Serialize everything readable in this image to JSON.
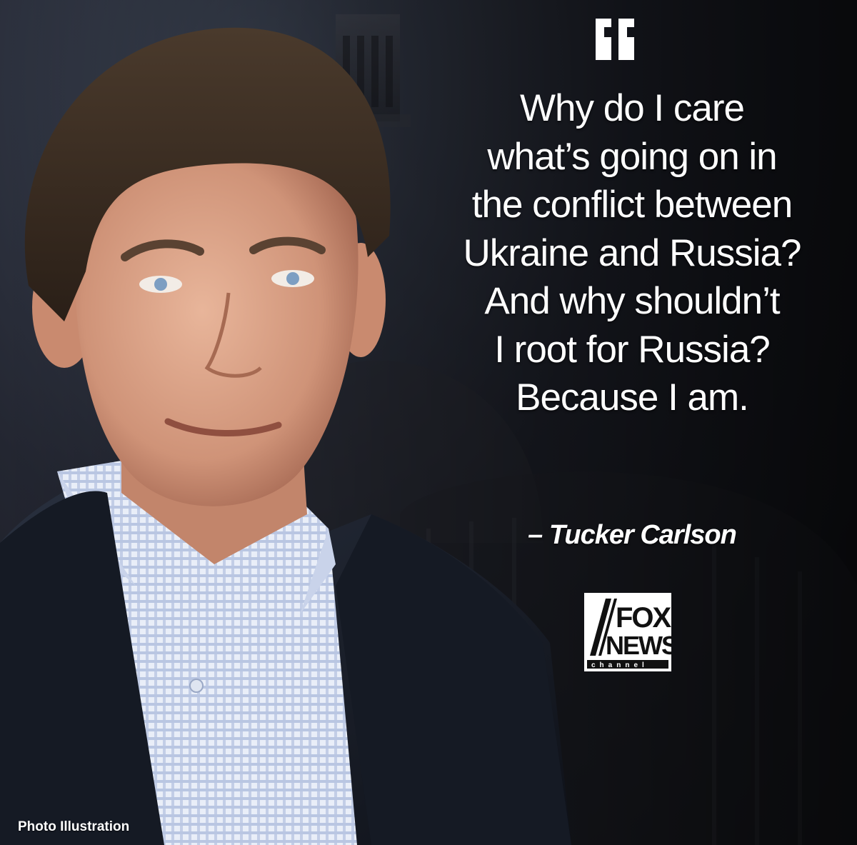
{
  "quote": {
    "lines": [
      "Why do I care",
      "what’s going on in",
      "the conflict between",
      "Ukraine and Russia?",
      "And why shouldn’t",
      "I root for Russia?",
      "Because I am."
    ],
    "attribution": "– Tucker Carlson"
  },
  "logo": {
    "name": "fox-news-channel-logo",
    "line1": "FOX",
    "line2": "NEWS",
    "line3": "channel"
  },
  "caption": "Photo Illustration",
  "colors": {
    "background": "#1b1c22",
    "text": "#ffffff"
  }
}
